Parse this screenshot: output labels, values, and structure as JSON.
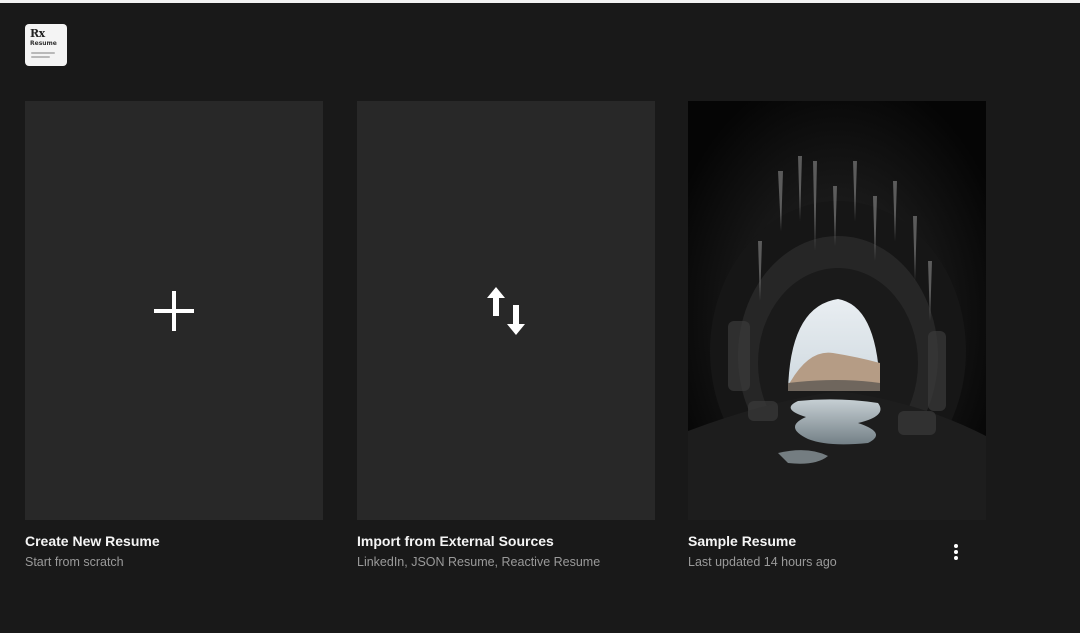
{
  "logo": {
    "mark": "Rx",
    "word": "Resume"
  },
  "cards": [
    {
      "title": "Create New Resume",
      "subtitle": "Start from scratch",
      "icon": "plus-icon"
    },
    {
      "title": "Import from External Sources",
      "subtitle": "LinkedIn, JSON Resume, Reactive Resume",
      "icon": "import-arrows-icon"
    },
    {
      "title": "Sample Resume",
      "subtitle": "Last updated 14 hours ago",
      "icon": "cave-tunnel-photo",
      "menu_icon": "more-vertical-icon"
    }
  ],
  "colors": {
    "background": "#191919",
    "card_background": "#282828",
    "title_text": "#f5f5f5",
    "subtitle_text": "#9a9a9a"
  }
}
